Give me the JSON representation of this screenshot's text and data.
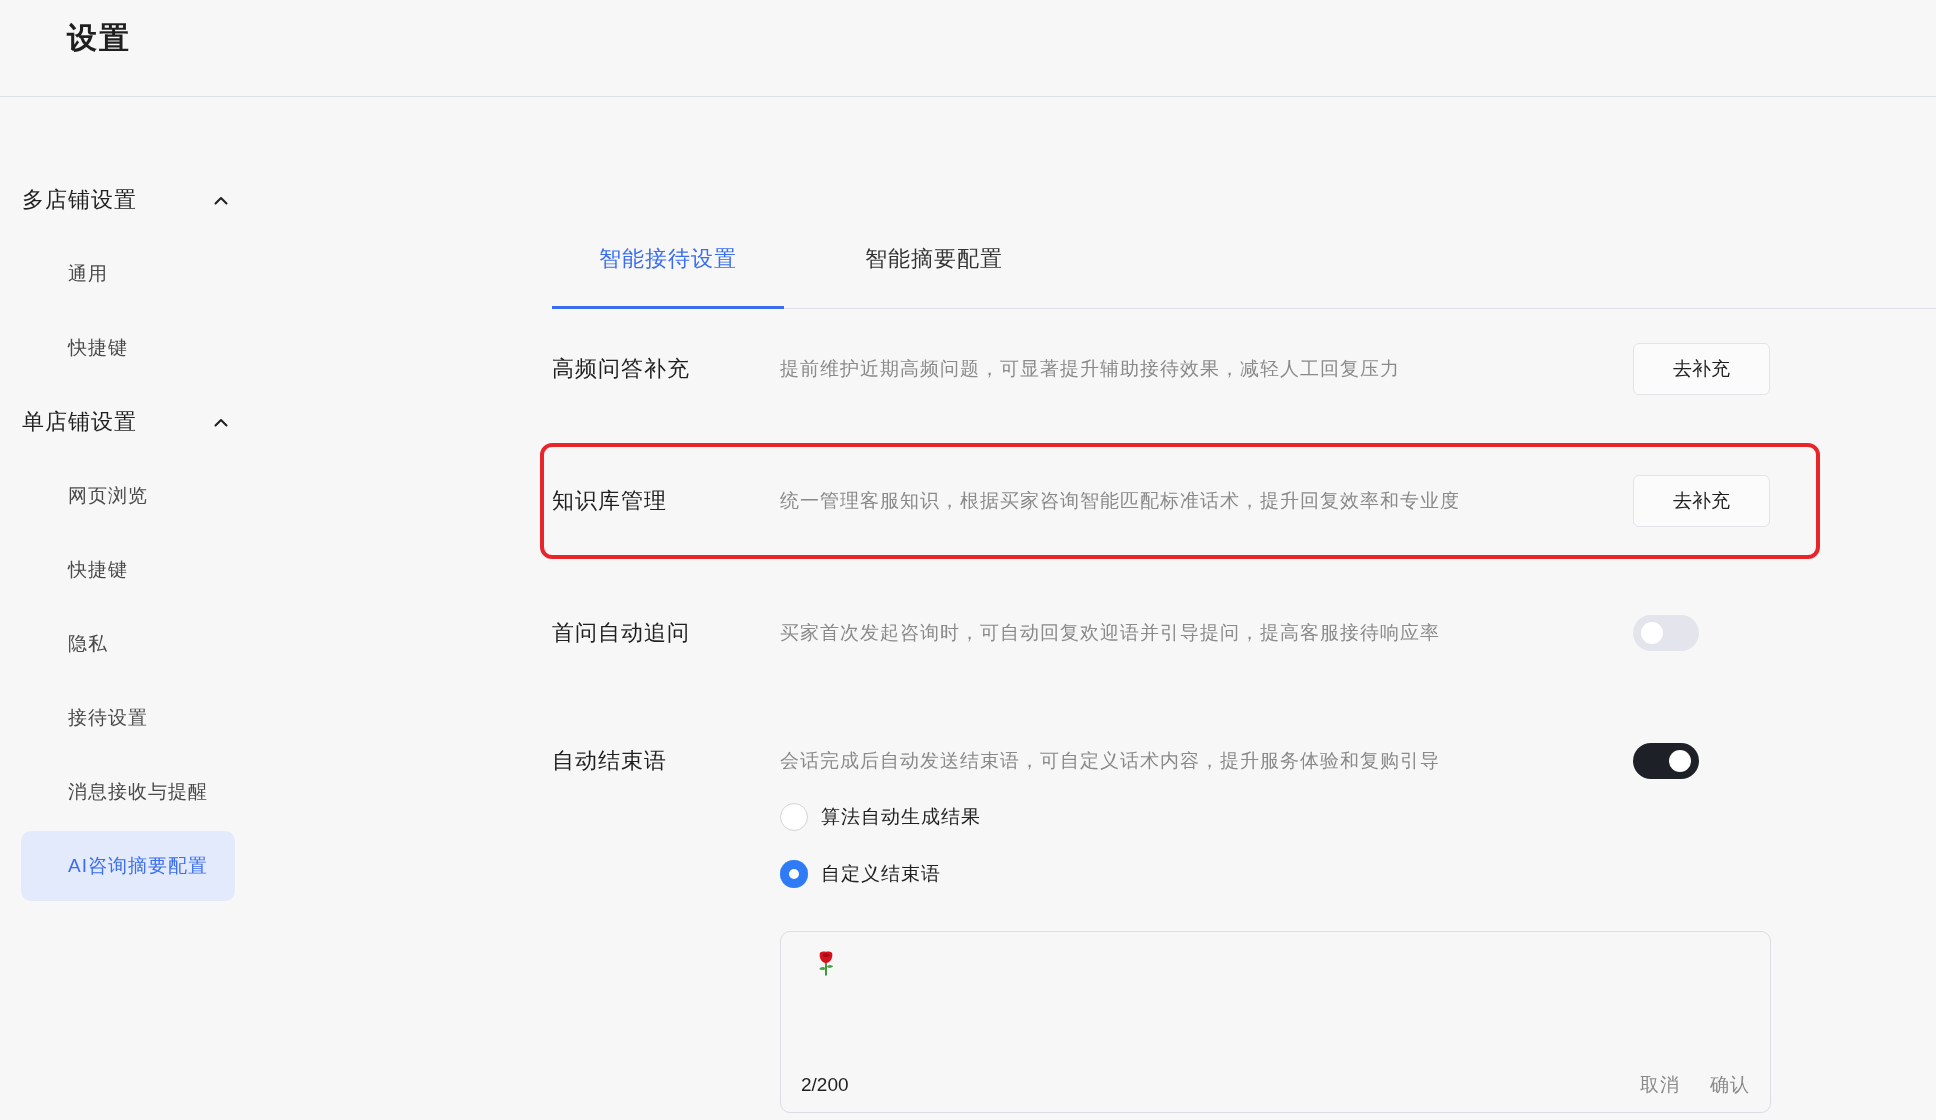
{
  "header": {
    "title": "设置"
  },
  "sidebar": {
    "groups": [
      {
        "label": "多店铺设置",
        "expanded": true,
        "items": [
          {
            "label": "通用",
            "selected": false
          },
          {
            "label": "快捷键",
            "selected": false
          }
        ]
      },
      {
        "label": "单店铺设置",
        "expanded": true,
        "items": [
          {
            "label": "网页浏览",
            "selected": false
          },
          {
            "label": "快捷键",
            "selected": false
          },
          {
            "label": "隐私",
            "selected": false
          },
          {
            "label": "接待设置",
            "selected": false
          },
          {
            "label": "消息接收与提醒",
            "selected": false
          },
          {
            "label": "AI咨询摘要配置",
            "selected": true
          }
        ]
      }
    ]
  },
  "tabs": [
    {
      "label": "智能接待设置",
      "selected": true
    },
    {
      "label": "智能摘要配置",
      "selected": false
    }
  ],
  "settings": [
    {
      "kind": "action",
      "label": "高频问答补充",
      "description": "提前维护近期高频问题，可显著提升辅助接待效果，减轻人工回复压力",
      "button": "去补充",
      "highlighted": false
    },
    {
      "kind": "action",
      "label": "知识库管理",
      "description": "统一管理客服知识，根据买家咨询智能匹配标准话术，提升回复效率和专业度",
      "button": "去补充",
      "highlighted": true
    },
    {
      "kind": "toggle",
      "label": "首问自动追问",
      "description": "买家首次发起咨询时，可自动回复欢迎语并引导提问，提高客服接待响应率",
      "on": false,
      "highlighted": false
    },
    {
      "kind": "toggle",
      "label": "自动结束语",
      "description": "会话完成后自动发送结束语，可自定义话术内容，提升服务体验和复购引导",
      "on": true,
      "highlighted": false,
      "options": [
        {
          "label": "算法自动生成结果",
          "selected": false
        },
        {
          "label": "自定义结束语",
          "selected": true
        }
      ],
      "editor": {
        "counter": "2/200",
        "actions": [
          "取消",
          "确认"
        ]
      }
    }
  ]
}
